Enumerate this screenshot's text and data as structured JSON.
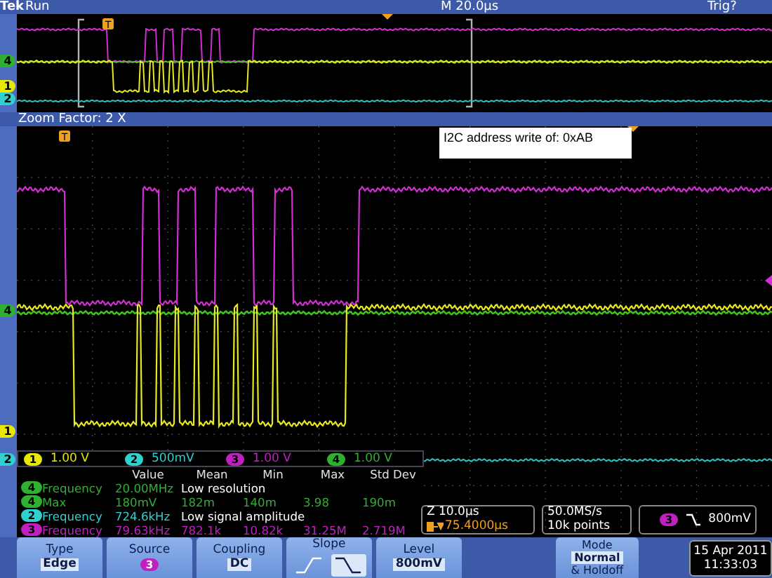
{
  "header": {
    "brand": "Tek",
    "state": "Run",
    "timebase": "M 20.0µs",
    "trigger_status": "Trig?"
  },
  "overview": {
    "trigger_marker": "T",
    "channel_markers": [
      {
        "label": "4",
        "color": "#30b030"
      },
      {
        "label": "1",
        "color": "#e8e800"
      },
      {
        "label": "2",
        "color": "#30d0d0"
      }
    ]
  },
  "zoom": {
    "factor": "Zoom Factor: 2 X",
    "trigger_marker": "T",
    "annotation": "I2C address write of: 0xAB",
    "channel_markers": [
      {
        "label": "4",
        "color": "#30b030"
      },
      {
        "label": "1",
        "color": "#e8e800"
      },
      {
        "label": "2",
        "color": "#30d0d0"
      }
    ]
  },
  "channels": [
    {
      "number": "1",
      "scale": "1.00 V",
      "color": "#e8e800"
    },
    {
      "number": "2",
      "scale": "500mV",
      "color": "#30d0d0"
    },
    {
      "number": "3",
      "scale": "1.00 V",
      "color": "#c020c0"
    },
    {
      "number": "4",
      "scale": "1.00 V",
      "color": "#30b030"
    }
  ],
  "measurements": {
    "columns": [
      "Value",
      "Mean",
      "Min",
      "Max",
      "Std Dev"
    ],
    "rows": [
      {
        "kind": "note",
        "channel": "4",
        "color": "#30b030",
        "name": "Frequency",
        "value": "20.00MHz",
        "note": "Low resolution"
      },
      {
        "kind": "stats",
        "channel": "4",
        "color": "#30b030",
        "name": "Max",
        "value": "180mV",
        "cells": [
          "182m",
          "140m",
          "3.98",
          "190m"
        ]
      },
      {
        "kind": "note",
        "channel": "2",
        "color": "#30d0d0",
        "name": "Frequency",
        "value": "724.6kHz",
        "note": "Low signal amplitude"
      },
      {
        "kind": "stats",
        "channel": "3",
        "color": "#c020c0",
        "name": "Frequency",
        "value": "79.63kHz",
        "cells": [
          "782.1k",
          "10.82k",
          "31.25M",
          "2.719M"
        ]
      }
    ]
  },
  "zoom_readout": {
    "scale": "Z 10.0µs",
    "position": "75.4000µs"
  },
  "acquisition": {
    "rate": "50.0MS/s",
    "length": "10k points"
  },
  "trigger_readout": {
    "source": "3",
    "color": "#c020c0",
    "kind": "falling",
    "level": "800mV"
  },
  "menu": [
    {
      "kind": "value",
      "label": "Type",
      "value": "Edge"
    },
    {
      "kind": "badge",
      "label": "Source",
      "value": "3",
      "color": "#c020c0"
    },
    {
      "kind": "value",
      "label": "Coupling",
      "value": "DC"
    },
    {
      "kind": "slope",
      "label": "Slope",
      "options": [
        {
          "kind": "rising",
          "selected": false
        },
        {
          "kind": "falling",
          "selected": true
        }
      ]
    },
    {
      "kind": "value",
      "label": "Level",
      "value": "800mV"
    },
    {
      "kind": "mode",
      "label": "Mode",
      "value": "Normal",
      "extra": "& Holdoff"
    }
  ],
  "datetime": {
    "date": "15 Apr 2011",
    "time": "11:33:03"
  }
}
